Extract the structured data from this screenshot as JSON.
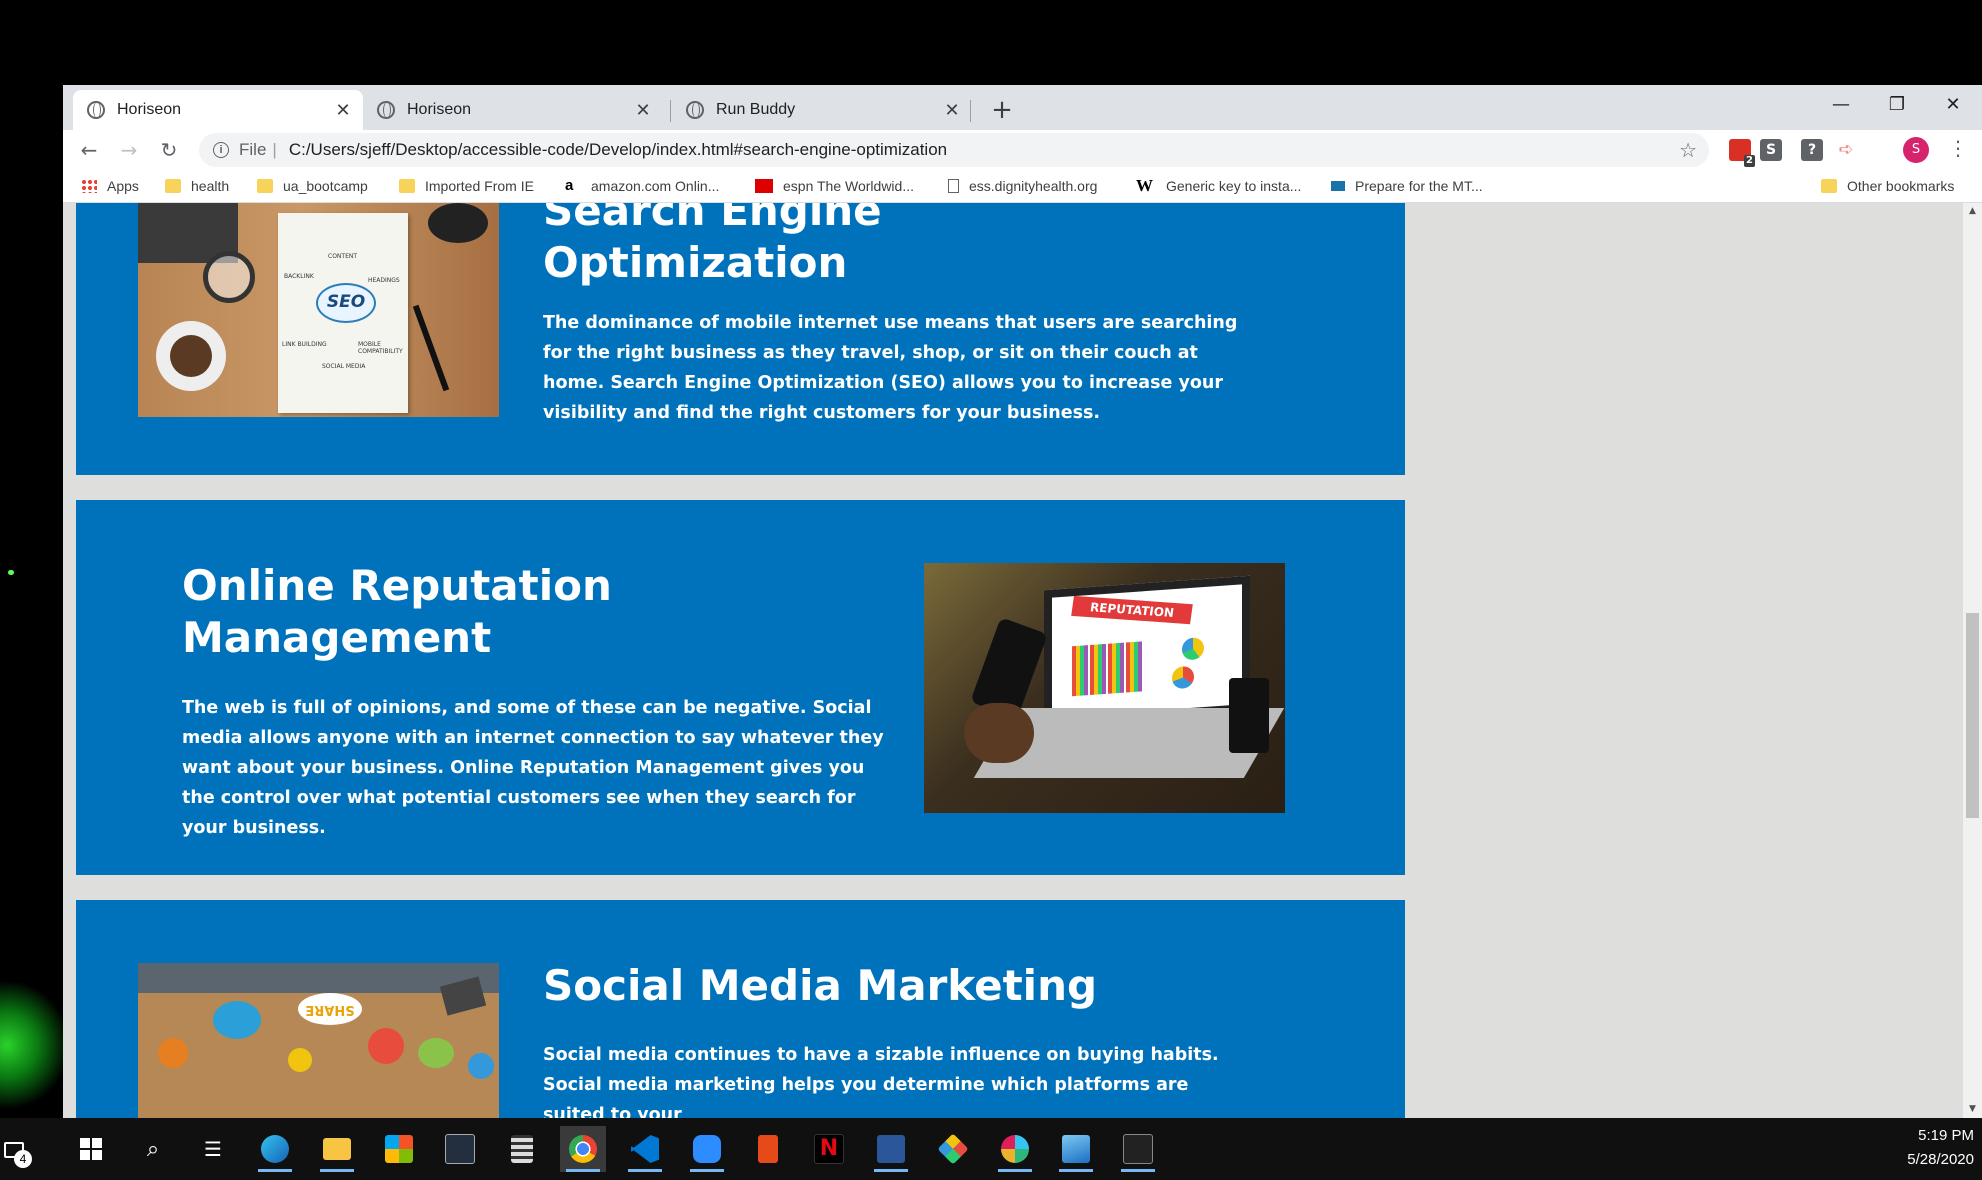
{
  "browser": {
    "tabs": [
      {
        "label": "Horiseon",
        "active": true
      },
      {
        "label": "Horiseon",
        "active": false
      },
      {
        "label": "Run Buddy",
        "active": false
      }
    ],
    "tab_close": "✕",
    "new_tab": "+",
    "window_controls": {
      "minimize": "—",
      "maximize": "❐",
      "close": "✕"
    },
    "address": {
      "scheme_label": "File",
      "url": "C:/Users/sjeff/Desktop/accessible-code/Develop/index.html#search-engine-optimization"
    },
    "extensions": [
      {
        "name": "todoist-extension-icon",
        "badge": "2",
        "color": "#d93025"
      },
      {
        "name": "script-extension-icon",
        "color": "#5f6368"
      },
      {
        "name": "help-extension-icon",
        "color": "#5f6368"
      },
      {
        "name": "cast-extension-icon",
        "color": "#f28b82"
      }
    ],
    "profile_initial": "S",
    "bookmarks": [
      {
        "label": "Apps",
        "icon": "apps-grid-icon"
      },
      {
        "label": "health",
        "icon": "folder-icon"
      },
      {
        "label": "ua_bootcamp",
        "icon": "folder-icon"
      },
      {
        "label": "Imported From IE",
        "icon": "folder-icon"
      },
      {
        "label": "amazon.com Onlin...",
        "icon": "amazon-icon"
      },
      {
        "label": "espn The Worldwid...",
        "icon": "espn-icon"
      },
      {
        "label": "ess.dignityhealth.org",
        "icon": "page-icon"
      },
      {
        "label": "Generic key to insta...",
        "icon": "w-icon"
      },
      {
        "label": "Prepare for the MT...",
        "icon": "video-icon"
      }
    ],
    "other_bookmarks": "Other bookmarks"
  },
  "page": {
    "sections": [
      {
        "title_line1": "Search Engine",
        "title_line2": "Optimization",
        "body": "The dominance of mobile internet use means that users are searching for the right business as they travel, shop, or sit on their couch at home. Search Engine Optimization (SEO) allows you to increase your visibility and find the right customers for your business.",
        "image_labels": {
          "center": "SEO",
          "a": "CONTENT",
          "b": "BACKLINK",
          "c": "HEADINGS",
          "d": "LINK BUILDING",
          "e": "MOBILE COMPATIBILITY",
          "f": "SOCIAL MEDIA"
        }
      },
      {
        "title_line1": "Online Reputation",
        "title_line2": "Management",
        "body": "The web is full of opinions, and some of these can be negative. Social media allows anyone with an internet connection to say whatever they want about your business. Online Reputation Management gives you the control over what potential customers see when they search for your business.",
        "image_labels": {
          "banner": "REPUTATION"
        }
      },
      {
        "title_line1": "Social Media Marketing",
        "body": "Social media continues to have a sizable influence on buying habits. Social media marketing helps you determine which platforms are suited to your",
        "image_labels": {
          "bubble": "SHARE"
        }
      }
    ]
  },
  "taskbar": {
    "notification_count": "4",
    "apps": [
      "windows-start-icon",
      "search-icon",
      "task-view-icon",
      "edge-icon",
      "file-explorer-icon",
      "store-icon",
      "amazon-icon",
      "calculator-icon",
      "chrome-icon",
      "vscode-icon",
      "zoom-icon",
      "office-icon",
      "netflix-icon",
      "word-icon",
      "git-icon",
      "slack-icon",
      "photos-icon",
      "terminal-icon"
    ],
    "time": "5:19 PM",
    "date": "5/28/2020"
  }
}
